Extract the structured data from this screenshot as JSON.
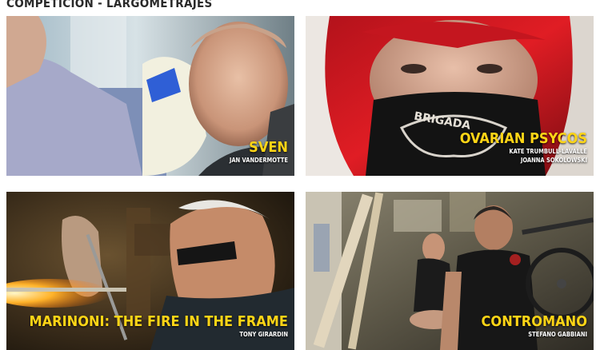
{
  "section": {
    "title": "COMPETICIÓN - LARGOMETRAJES"
  },
  "films": [
    {
      "title": "SVEN",
      "directors": [
        "JAN VANDERMOTTE"
      ]
    },
    {
      "title": "OVARIAN PSYCOS",
      "directors": [
        "KATE TRUMBULL-LAVALLE",
        "JOANNA SOKOLOWSKI"
      ]
    },
    {
      "title": "MARINONI: THE FIRE IN THE FRAME",
      "directors": [
        "TONY GIRARDIN"
      ]
    },
    {
      "title": "CONTROMANO",
      "directors": [
        "STEFANO GABBIANI"
      ]
    }
  ],
  "image_text": {
    "bandana": "BRIGADA"
  },
  "colors": {
    "title_yellow": "#ffd516",
    "director_white": "#ffffff"
  }
}
